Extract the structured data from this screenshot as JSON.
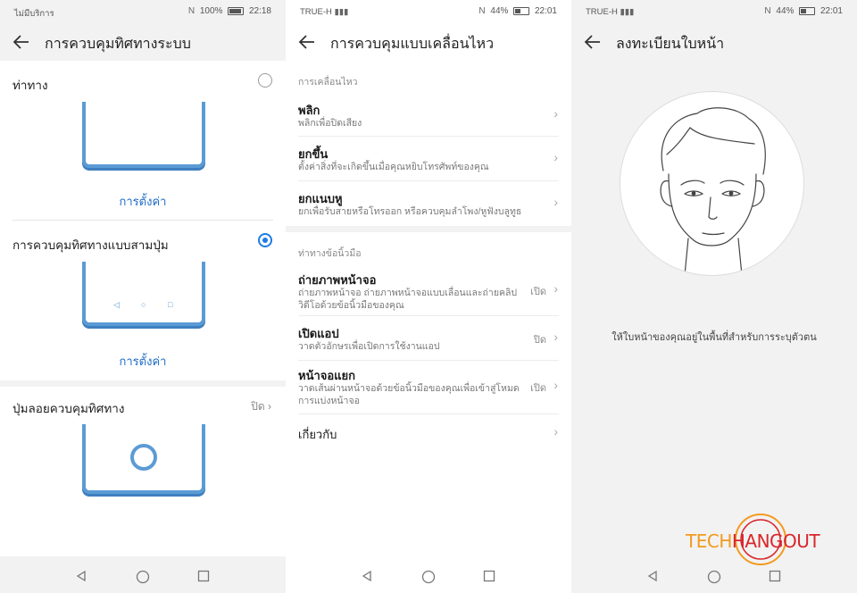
{
  "panels": [
    {
      "status": {
        "left": "ไม่มีบริการ",
        "battery": "100%",
        "time": "22:18"
      },
      "title": "การควบคุมทิศทางระบบ",
      "options": [
        {
          "label": "ท่าทาง",
          "selected": false,
          "settings_link": "การตั้งค่า"
        },
        {
          "label": "การควบคุมทิศทางแบบสามปุ่ม",
          "selected": true,
          "settings_link": "การตั้งค่า"
        }
      ],
      "floating": {
        "label": "ปุ่มลอยควบคุมทิศทาง",
        "value": "ปิด"
      }
    },
    {
      "status": {
        "carrier": "TRUE-H",
        "battery": "44%",
        "time": "22:01"
      },
      "title": "การควบคุมแบบเคลื่อนไหว",
      "sections": [
        {
          "header": "การเคลื่อนไหว",
          "items": [
            {
              "title": "พลิก",
              "subtitle": "พลิกเพื่อปิดเสียง",
              "value": ""
            },
            {
              "title": "ยกขึ้น",
              "subtitle": "ตั้งค่าสิ่งที่จะเกิดขึ้นเมื่อคุณหยิบโทรศัพท์ของคุณ",
              "value": ""
            },
            {
              "title": "ยกแนบหู",
              "subtitle": "ยกเพื่อรับสายหรือโทรออก หรือควบคุมลำโพง/หูฟังบลูทูธ",
              "value": ""
            }
          ]
        },
        {
          "header": "ท่าทางข้อนิ้วมือ",
          "items": [
            {
              "title": "ถ่ายภาพหน้าจอ",
              "subtitle": "ถ่ายภาพหน้าจอ ถ่ายภาพหน้าจอแบบเลื่อนและถ่ายคลิปวิดีโอด้วยข้อนิ้วมือของคุณ",
              "value": "เปิด"
            },
            {
              "title": "เปิดแอป",
              "subtitle": "วาดตัวอักษรเพื่อเปิดการใช้งานแอป",
              "value": "ปิด"
            },
            {
              "title": "หน้าจอแยก",
              "subtitle": "วาดเส้นผ่านหน้าจอด้วยข้อนิ้วมือของคุณเพื่อเข้าสู่โหมดการแบ่งหน้าจอ",
              "value": "เปิด"
            }
          ]
        }
      ],
      "about": "เกี่ยวกับ"
    },
    {
      "status": {
        "carrier": "TRUE-H",
        "battery": "44%",
        "time": "22:01"
      },
      "title": "ลงทะเบียนใบหน้า",
      "hint": "ให้ใบหน้าของคุณอยู่ในพื้นที่สำหรับการระบุตัวตน",
      "watermark": {
        "part1": "TECH",
        "part2": "HANGOUT"
      }
    }
  ],
  "colors": {
    "accent": "#1e7ce6",
    "phone_outline": "#5b9bd5",
    "logo_orange": "#f39a1e",
    "logo_red": "#d9262b"
  },
  "icons": [
    "back-arrow-icon",
    "chevron-right-icon",
    "nav-back-icon",
    "nav-home-icon",
    "nav-recents-icon",
    "radio-icon",
    "battery-icon"
  ]
}
